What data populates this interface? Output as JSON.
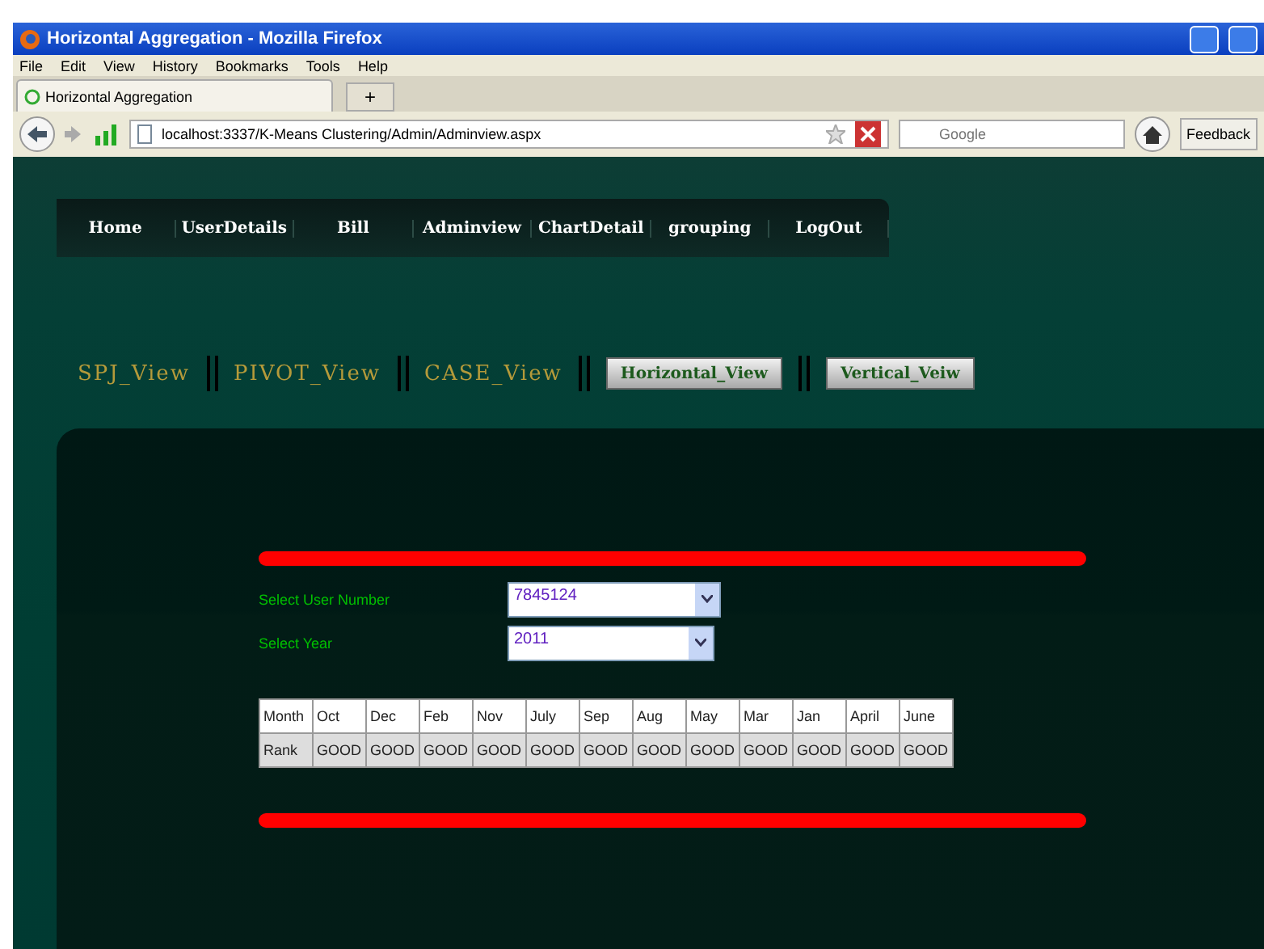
{
  "window": {
    "title": "Horizontal Aggregation - Mozilla Firefox"
  },
  "menu": [
    "File",
    "Edit",
    "View",
    "History",
    "Bookmarks",
    "Tools",
    "Help"
  ],
  "tabs": [
    {
      "label": "Horizontal Aggregation",
      "selected": true
    }
  ],
  "new_tab": "+",
  "address": "localhost:3337/K-Means Clustering/Admin/Adminview.aspx",
  "search": {
    "placeholder": "Google"
  },
  "feedback": "Feedback",
  "nav": [
    "Home",
    "UserDetails",
    "Bill",
    "Adminview",
    "ChartDetail",
    "grouping",
    "LogOut"
  ],
  "views": [
    {
      "label": "SPJ_View",
      "kind": "link"
    },
    {
      "label": "PIVOT_View",
      "kind": "link"
    },
    {
      "label": "CASE_View",
      "kind": "link"
    },
    {
      "label": "Horizontal_View",
      "kind": "button"
    },
    {
      "label": "Vertical_Veiw",
      "kind": "button"
    }
  ],
  "form": [
    {
      "label": "Select User Number",
      "value": "7845124"
    },
    {
      "label": "Select Year",
      "value": "2011"
    }
  ],
  "table": {
    "rows": [
      [
        "Month",
        "Oct",
        "Dec",
        "Feb",
        "Nov",
        "July",
        "Sep",
        "Aug",
        "May",
        "Mar",
        "Jan",
        "April",
        "June"
      ],
      [
        "Rank",
        "GOOD",
        "GOOD",
        "GOOD",
        "GOOD",
        "GOOD",
        "GOOD",
        "GOOD",
        "GOOD",
        "GOOD",
        "GOOD",
        "GOOD",
        "GOOD"
      ]
    ]
  }
}
